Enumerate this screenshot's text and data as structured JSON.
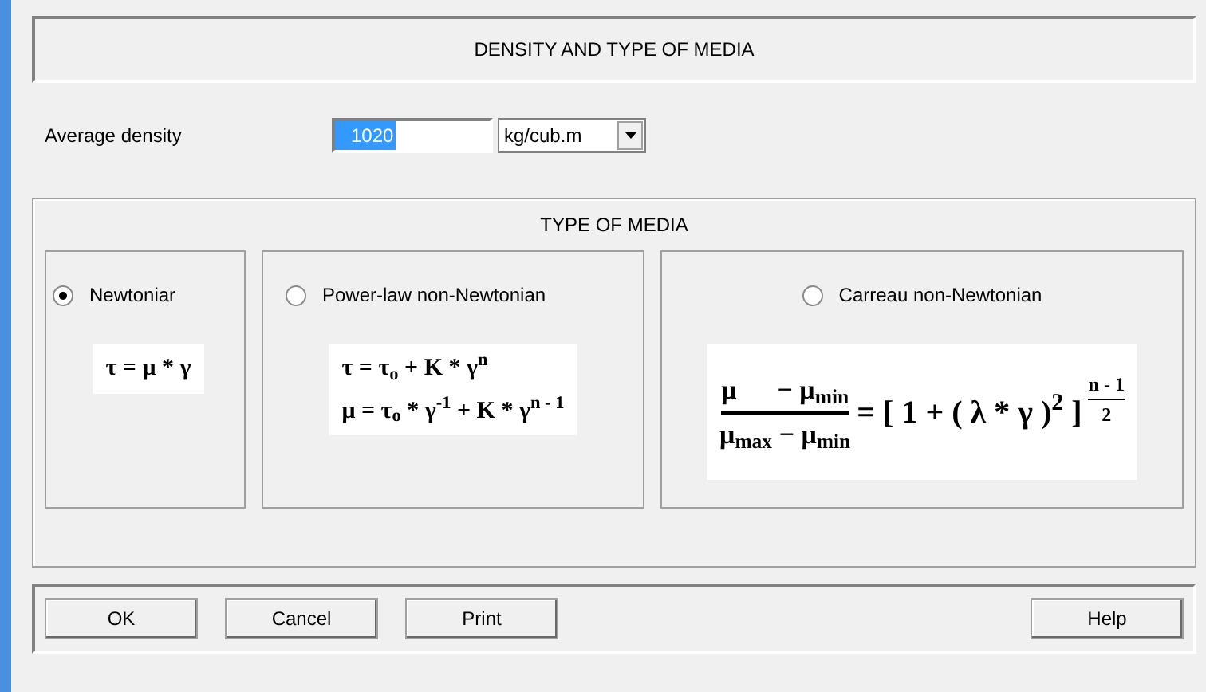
{
  "header": {
    "title": "DENSITY AND TYPE OF MEDIA"
  },
  "density": {
    "label": "Average density",
    "value": "1020",
    "value_highlighted": true,
    "unit": "kg/cub.m"
  },
  "media": {
    "title": "TYPE OF MEDIA",
    "options": [
      {
        "label": "Newtoniar",
        "selected": true,
        "kind": "lines",
        "formula_lines": [
          "τ = μ * γ"
        ]
      },
      {
        "label": "Power-law non-Newtonian",
        "selected": false,
        "kind": "lines",
        "formula_lines": [
          "τ = τ$_{o}$ + K * γ$^{n}$",
          "μ = τ$_{o}$ * γ$^{-1}$ + K * γ$^{n - 1}$"
        ]
      },
      {
        "label": "Carreau non-Newtonian",
        "selected": false,
        "kind": "fraction",
        "numerator": "μ      − μ$_{min}$",
        "denominator": "μ$_{max}$ − μ$_{min}$",
        "rhs": "= [ 1 + ( λ * γ )$^{2}$ ]",
        "exponent_numerator": "n - 1",
        "exponent_denominator": "2"
      }
    ]
  },
  "buttons": [
    "OK",
    "Cancel",
    "Print"
  ],
  "help_button": "Help"
}
